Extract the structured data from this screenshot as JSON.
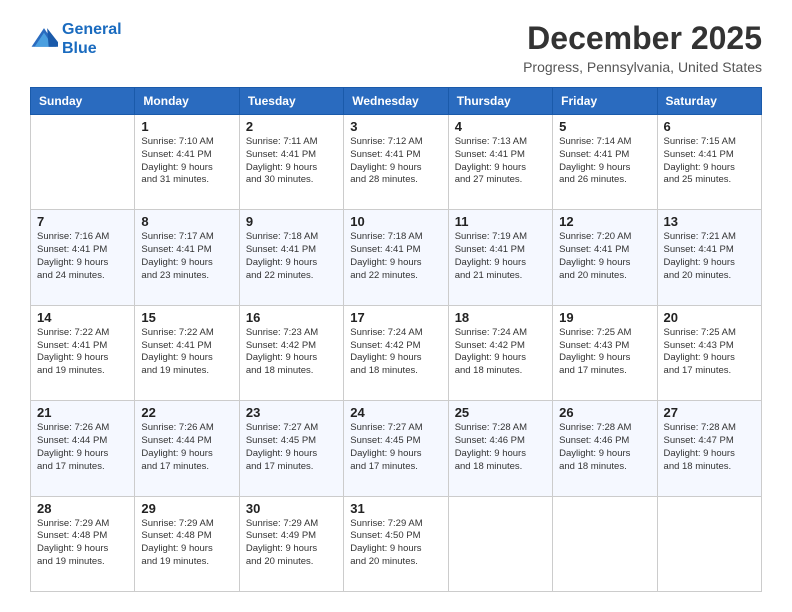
{
  "logo": {
    "line1": "General",
    "line2": "Blue"
  },
  "title": "December 2025",
  "subtitle": "Progress, Pennsylvania, United States",
  "headers": [
    "Sunday",
    "Monday",
    "Tuesday",
    "Wednesday",
    "Thursday",
    "Friday",
    "Saturday"
  ],
  "weeks": [
    [
      {
        "day": "",
        "info": ""
      },
      {
        "day": "1",
        "info": "Sunrise: 7:10 AM\nSunset: 4:41 PM\nDaylight: 9 hours\nand 31 minutes."
      },
      {
        "day": "2",
        "info": "Sunrise: 7:11 AM\nSunset: 4:41 PM\nDaylight: 9 hours\nand 30 minutes."
      },
      {
        "day": "3",
        "info": "Sunrise: 7:12 AM\nSunset: 4:41 PM\nDaylight: 9 hours\nand 28 minutes."
      },
      {
        "day": "4",
        "info": "Sunrise: 7:13 AM\nSunset: 4:41 PM\nDaylight: 9 hours\nand 27 minutes."
      },
      {
        "day": "5",
        "info": "Sunrise: 7:14 AM\nSunset: 4:41 PM\nDaylight: 9 hours\nand 26 minutes."
      },
      {
        "day": "6",
        "info": "Sunrise: 7:15 AM\nSunset: 4:41 PM\nDaylight: 9 hours\nand 25 minutes."
      }
    ],
    [
      {
        "day": "7",
        "info": "Sunrise: 7:16 AM\nSunset: 4:41 PM\nDaylight: 9 hours\nand 24 minutes."
      },
      {
        "day": "8",
        "info": "Sunrise: 7:17 AM\nSunset: 4:41 PM\nDaylight: 9 hours\nand 23 minutes."
      },
      {
        "day": "9",
        "info": "Sunrise: 7:18 AM\nSunset: 4:41 PM\nDaylight: 9 hours\nand 22 minutes."
      },
      {
        "day": "10",
        "info": "Sunrise: 7:18 AM\nSunset: 4:41 PM\nDaylight: 9 hours\nand 22 minutes."
      },
      {
        "day": "11",
        "info": "Sunrise: 7:19 AM\nSunset: 4:41 PM\nDaylight: 9 hours\nand 21 minutes."
      },
      {
        "day": "12",
        "info": "Sunrise: 7:20 AM\nSunset: 4:41 PM\nDaylight: 9 hours\nand 20 minutes."
      },
      {
        "day": "13",
        "info": "Sunrise: 7:21 AM\nSunset: 4:41 PM\nDaylight: 9 hours\nand 20 minutes."
      }
    ],
    [
      {
        "day": "14",
        "info": "Sunrise: 7:22 AM\nSunset: 4:41 PM\nDaylight: 9 hours\nand 19 minutes."
      },
      {
        "day": "15",
        "info": "Sunrise: 7:22 AM\nSunset: 4:41 PM\nDaylight: 9 hours\nand 19 minutes."
      },
      {
        "day": "16",
        "info": "Sunrise: 7:23 AM\nSunset: 4:42 PM\nDaylight: 9 hours\nand 18 minutes."
      },
      {
        "day": "17",
        "info": "Sunrise: 7:24 AM\nSunset: 4:42 PM\nDaylight: 9 hours\nand 18 minutes."
      },
      {
        "day": "18",
        "info": "Sunrise: 7:24 AM\nSunset: 4:42 PM\nDaylight: 9 hours\nand 18 minutes."
      },
      {
        "day": "19",
        "info": "Sunrise: 7:25 AM\nSunset: 4:43 PM\nDaylight: 9 hours\nand 17 minutes."
      },
      {
        "day": "20",
        "info": "Sunrise: 7:25 AM\nSunset: 4:43 PM\nDaylight: 9 hours\nand 17 minutes."
      }
    ],
    [
      {
        "day": "21",
        "info": "Sunrise: 7:26 AM\nSunset: 4:44 PM\nDaylight: 9 hours\nand 17 minutes."
      },
      {
        "day": "22",
        "info": "Sunrise: 7:26 AM\nSunset: 4:44 PM\nDaylight: 9 hours\nand 17 minutes."
      },
      {
        "day": "23",
        "info": "Sunrise: 7:27 AM\nSunset: 4:45 PM\nDaylight: 9 hours\nand 17 minutes."
      },
      {
        "day": "24",
        "info": "Sunrise: 7:27 AM\nSunset: 4:45 PM\nDaylight: 9 hours\nand 17 minutes."
      },
      {
        "day": "25",
        "info": "Sunrise: 7:28 AM\nSunset: 4:46 PM\nDaylight: 9 hours\nand 18 minutes."
      },
      {
        "day": "26",
        "info": "Sunrise: 7:28 AM\nSunset: 4:46 PM\nDaylight: 9 hours\nand 18 minutes."
      },
      {
        "day": "27",
        "info": "Sunrise: 7:28 AM\nSunset: 4:47 PM\nDaylight: 9 hours\nand 18 minutes."
      }
    ],
    [
      {
        "day": "28",
        "info": "Sunrise: 7:29 AM\nSunset: 4:48 PM\nDaylight: 9 hours\nand 19 minutes."
      },
      {
        "day": "29",
        "info": "Sunrise: 7:29 AM\nSunset: 4:48 PM\nDaylight: 9 hours\nand 19 minutes."
      },
      {
        "day": "30",
        "info": "Sunrise: 7:29 AM\nSunset: 4:49 PM\nDaylight: 9 hours\nand 20 minutes."
      },
      {
        "day": "31",
        "info": "Sunrise: 7:29 AM\nSunset: 4:50 PM\nDaylight: 9 hours\nand 20 minutes."
      },
      {
        "day": "",
        "info": ""
      },
      {
        "day": "",
        "info": ""
      },
      {
        "day": "",
        "info": ""
      }
    ]
  ]
}
